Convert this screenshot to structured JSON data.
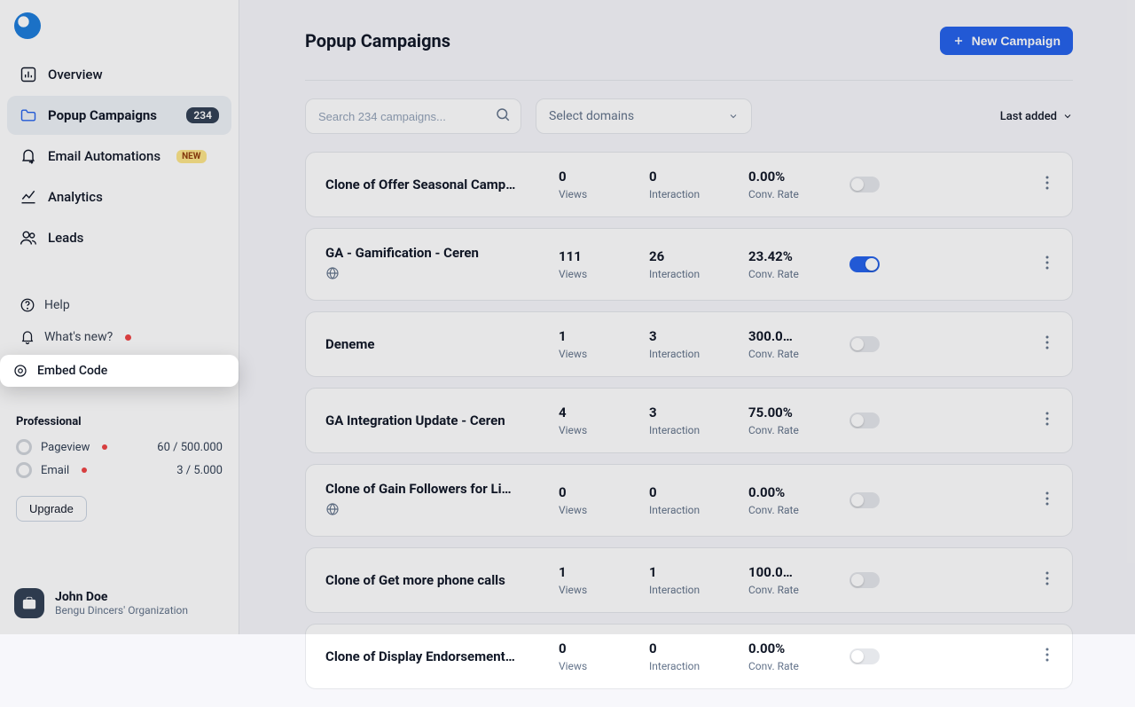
{
  "page": {
    "title": "Popup Campaigns",
    "new_button": "New Campaign"
  },
  "sidebar": {
    "nav": [
      {
        "key": "overview",
        "label": "Overview",
        "icon": "bar-chart-icon"
      },
      {
        "key": "popup-campaigns",
        "label": "Popup Campaigns",
        "icon": "folder-icon",
        "badge": "234",
        "active": true
      },
      {
        "key": "email-automations",
        "label": "Email Automations",
        "icon": "bell-forward-icon",
        "new_tag": "New"
      },
      {
        "key": "analytics",
        "label": "Analytics",
        "icon": "line-chart-icon"
      },
      {
        "key": "leads",
        "label": "Leads",
        "icon": "users-icon"
      }
    ],
    "lower": [
      {
        "key": "help",
        "label": "Help",
        "icon": "help-circle-icon"
      },
      {
        "key": "whats-new",
        "label": "What's new?",
        "icon": "bell-icon",
        "dot": true
      },
      {
        "key": "embed-code",
        "label": "Embed Code",
        "icon": "target-icon",
        "highlight": true
      }
    ]
  },
  "plan": {
    "tier": "Professional",
    "rows": [
      {
        "label": "Pageview",
        "value": "60 / 500.000",
        "dot": true
      },
      {
        "label": "Email",
        "value": "3 / 5.000",
        "dot": true
      }
    ],
    "upgrade_label": "Upgrade"
  },
  "user": {
    "name": "John Doe",
    "org": "Bengu Dincers' Organization"
  },
  "filters": {
    "search_placeholder": "Search 234 campaigns...",
    "domain_select": "Select domains",
    "sort_label": "Last added"
  },
  "stat_labels": {
    "views": "Views",
    "interaction": "Interaction",
    "conv_rate": "Conv. Rate"
  },
  "campaigns": [
    {
      "name": "Clone of Offer Seasonal Camp…",
      "views": "0",
      "interaction": "0",
      "conv": "0.00%",
      "on": false,
      "globe": false
    },
    {
      "name": "GA - Gamification - Ceren",
      "views": "111",
      "interaction": "26",
      "conv": "23.42%",
      "on": true,
      "globe": true
    },
    {
      "name": "Deneme",
      "views": "1",
      "interaction": "3",
      "conv": "300.0…",
      "on": false,
      "globe": false
    },
    {
      "name": "GA Integration Update - Ceren",
      "views": "4",
      "interaction": "3",
      "conv": "75.00%",
      "on": false,
      "globe": false
    },
    {
      "name": "Clone of Gain Followers for Li…",
      "views": "0",
      "interaction": "0",
      "conv": "0.00%",
      "on": false,
      "globe": true
    },
    {
      "name": "Clone of Get more phone calls",
      "views": "1",
      "interaction": "1",
      "conv": "100.0…",
      "on": false,
      "globe": false
    },
    {
      "name": "Clone of Display Endorsement…",
      "views": "0",
      "interaction": "0",
      "conv": "0.00%",
      "on": false,
      "globe": false
    }
  ]
}
